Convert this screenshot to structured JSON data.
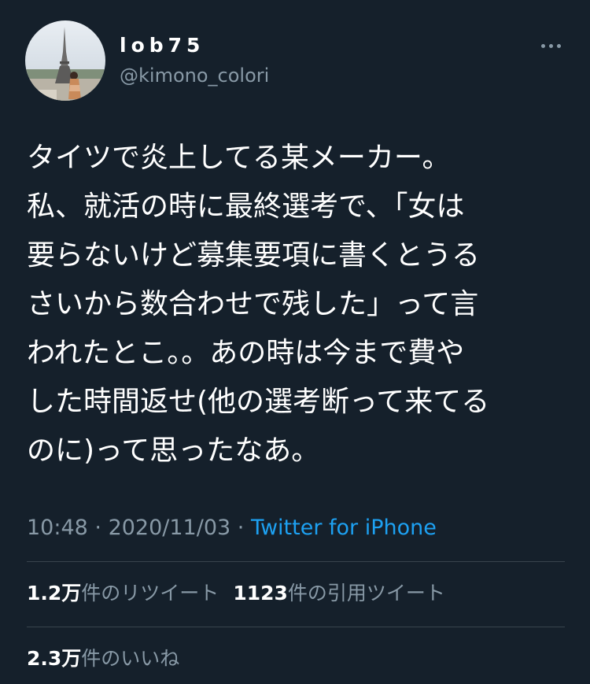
{
  "author": {
    "display_name": "lob75",
    "handle": "@kimono_colori"
  },
  "tweet": {
    "lines": [
      "タイツで炎上してる某メーカー。",
      "私、就活の時に最終選考で、「女は",
      "要らないけど募集要項に書くとうる",
      "さいから数合わせで残した」って言",
      "われたとこ。。あの時は今まで費や",
      "した時間返せ(他の選考断って来てる",
      "のに)って思ったなあ。"
    ]
  },
  "meta": {
    "time": "10:48",
    "separator": " · ",
    "date": "2020/11/03",
    "source": "Twitter for iPhone"
  },
  "stats": {
    "retweets": {
      "count": "1.2万",
      "label": "件のリツイート"
    },
    "quotes": {
      "count": "1123",
      "label": "件の引用ツイート"
    },
    "likes": {
      "count": "2.3万",
      "label": "件のいいね"
    }
  },
  "icons": {
    "more": "more-horizontal-icon"
  },
  "colors": {
    "background": "#15202b",
    "text": "#ffffff",
    "secondary_text": "#8899a6",
    "link": "#1da1f2",
    "divider": "#38444d"
  }
}
